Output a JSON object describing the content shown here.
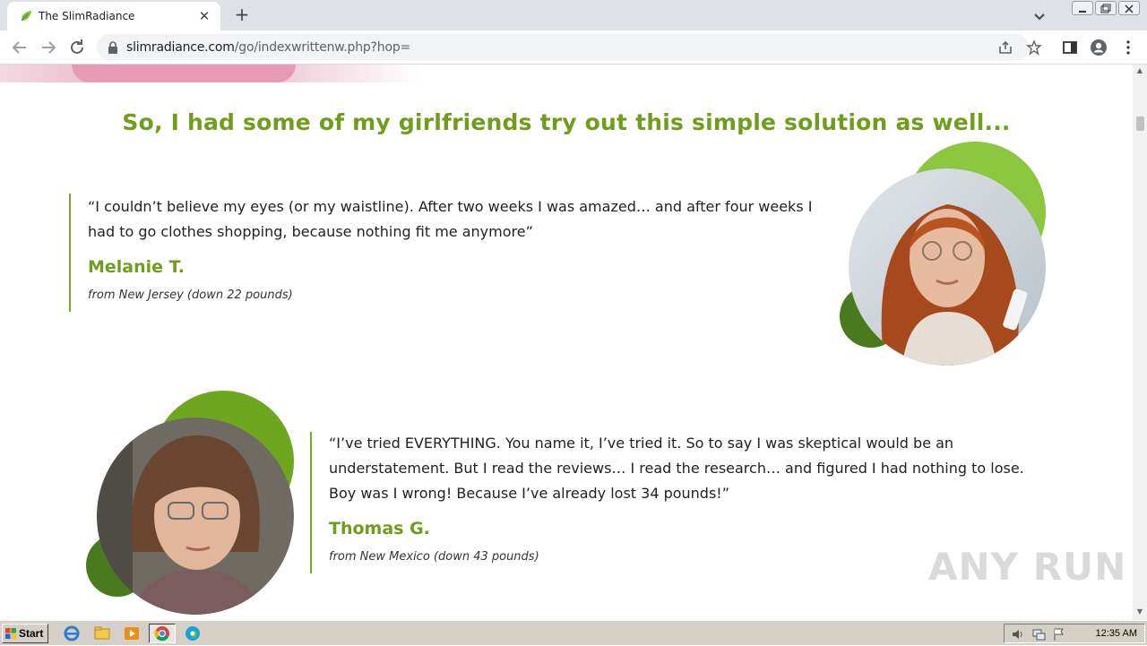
{
  "browser": {
    "tab_title": "The SlimRadiance",
    "url_host": "slimradiance.com",
    "url_path": "/go/indexwrittenw.php?hop="
  },
  "page": {
    "headline": "So, I had some of my girlfriends try out this simple solution as well...",
    "testimonials": [
      {
        "quote": "“I couldn’t believe my eyes (or my waistline). After two weeks I was amazed… and after four weeks I had to go clothes shopping, because nothing fit me anymore”",
        "name": "Melanie T.",
        "meta": "from New Jersey (down 22 pounds)"
      },
      {
        "quote": "“I’ve tried EVERYTHING. You name it, I’ve tried it. So to say I was skeptical would be an understatement. But I read the reviews… I read the research… and figured I had nothing to lose. Boy was I wrong! Because I’ve already lost 34 pounds!”",
        "name": "Thomas G.",
        "meta": "from New Mexico (down 43 pounds)"
      }
    ]
  },
  "watermark": "ANY RUN",
  "taskbar": {
    "start_label": "Start",
    "clock": "12:35 AM"
  },
  "colors": {
    "accent_green": "#6f9e1d",
    "light_green": "#8dc63f",
    "dark_green": "#4a7a1e"
  }
}
